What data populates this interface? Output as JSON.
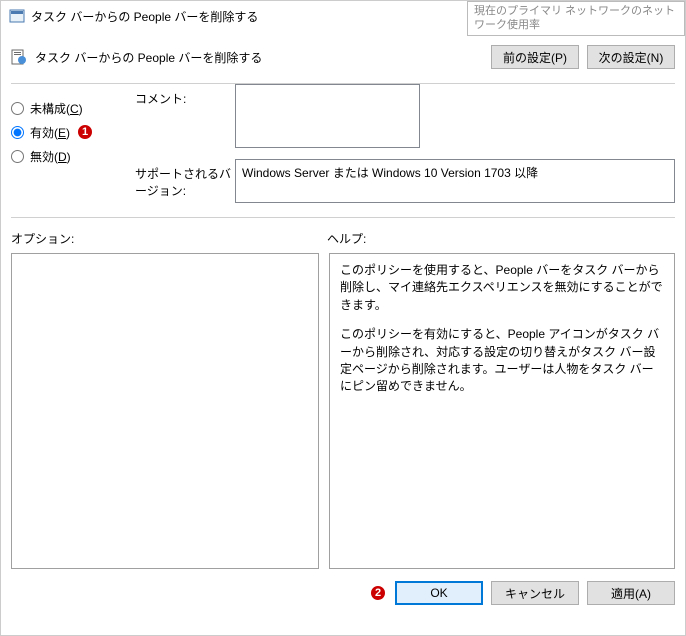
{
  "window": {
    "title": "タスク バーからの People バーを削除する"
  },
  "tooltip": {
    "text": "現在のプライマリ ネットワークのネットワーク使用率"
  },
  "policy": {
    "name": "タスク バーからの People バーを削除する"
  },
  "nav": {
    "prev": "前の設定(P)",
    "next": "次の設定(N)"
  },
  "radios": {
    "not_configured": "未構成(C)",
    "not_configured_hotkey": "C",
    "enabled": "有効(E)",
    "enabled_hotkey": "E",
    "disabled": "無効(D)",
    "disabled_hotkey": "D"
  },
  "annotations": {
    "badge1": "1",
    "badge2": "2"
  },
  "fields": {
    "comment_label": "コメント:",
    "comment_value": "",
    "supported_label": "サポートされるバージョン:",
    "supported_value": "Windows Server または Windows 10 Version 1703 以降"
  },
  "sections": {
    "options": "オプション:",
    "help": "ヘルプ:"
  },
  "help": {
    "p1": "このポリシーを使用すると、People バーをタスク バーから削除し、マイ連絡先エクスペリエンスを無効にすることができます。",
    "p2": "このポリシーを有効にすると、People アイコンがタスク バーから削除され、対応する設定の切り替えがタスク バー設定ページから削除されます。ユーザーは人物をタスク バーにピン留めできません。"
  },
  "footer": {
    "ok": "OK",
    "cancel": "キャンセル",
    "apply": "適用(A)"
  }
}
